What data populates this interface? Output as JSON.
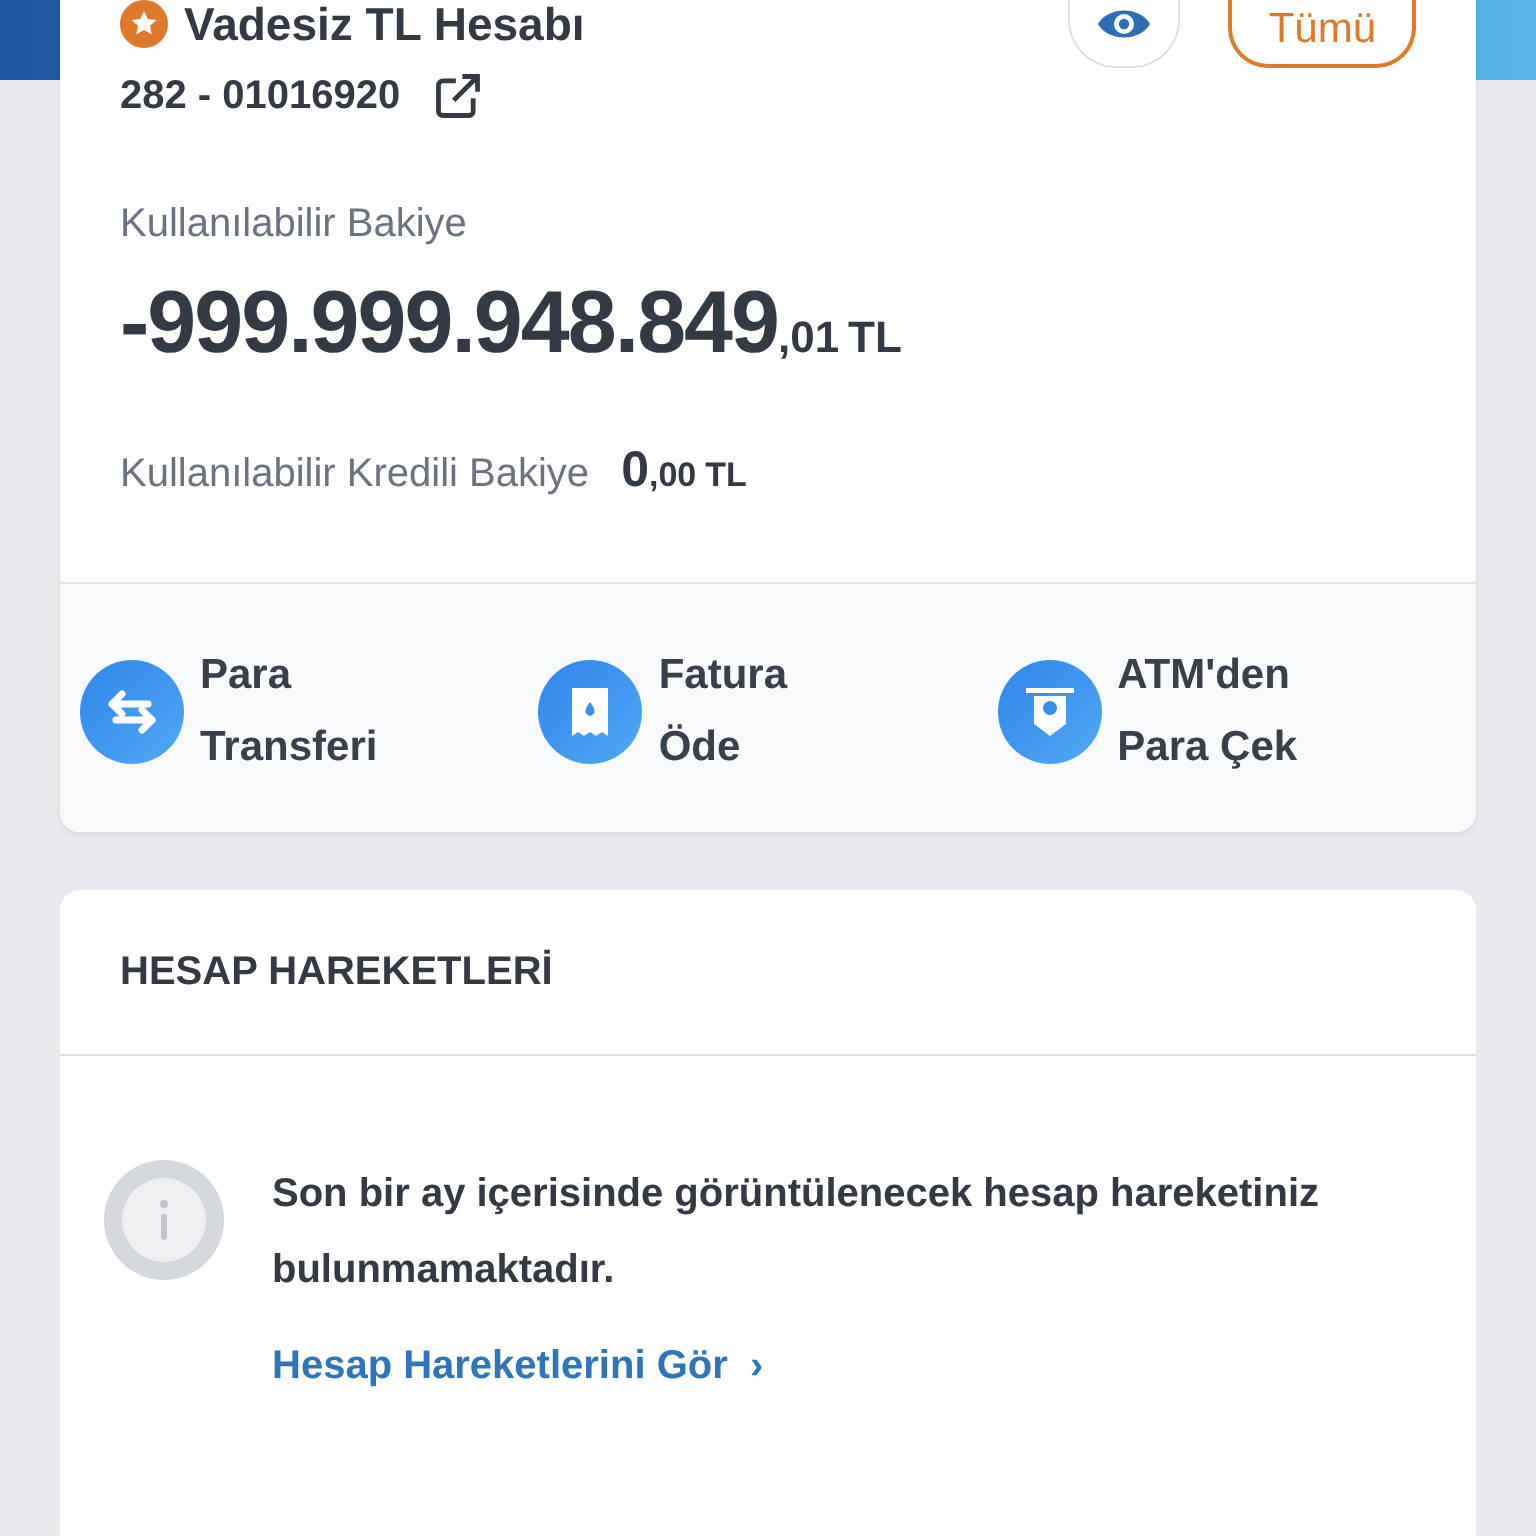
{
  "account": {
    "name": "Vadesiz TL Hesabı",
    "favorite": true,
    "number": "282 - 01016920",
    "all_button": "Tümü"
  },
  "balance": {
    "label": "Kullanılabilir Bakiye",
    "integer": "-999.999.948.849",
    "fraction": ",01",
    "currency": "TL"
  },
  "credit_balance": {
    "label": "Kullanılabilir Kredili Bakiye",
    "integer": "0",
    "fraction": ",00",
    "currency": "TL"
  },
  "actions": [
    {
      "kind": "transfer",
      "lines": [
        "Para",
        "Transferi"
      ]
    },
    {
      "kind": "bill",
      "lines": [
        "Fatura",
        "Öde"
      ]
    },
    {
      "kind": "atm",
      "lines": [
        "ATM'den",
        "Para Çek"
      ]
    }
  ],
  "transactions": {
    "title": "HESAP HAREKETLERİ",
    "message": "Son bir ay içerisinde görüntülenecek hesap hareketiniz bulunmamaktadır.",
    "link": "Hesap Hareketlerini Gör",
    "link_arrow": "›"
  }
}
